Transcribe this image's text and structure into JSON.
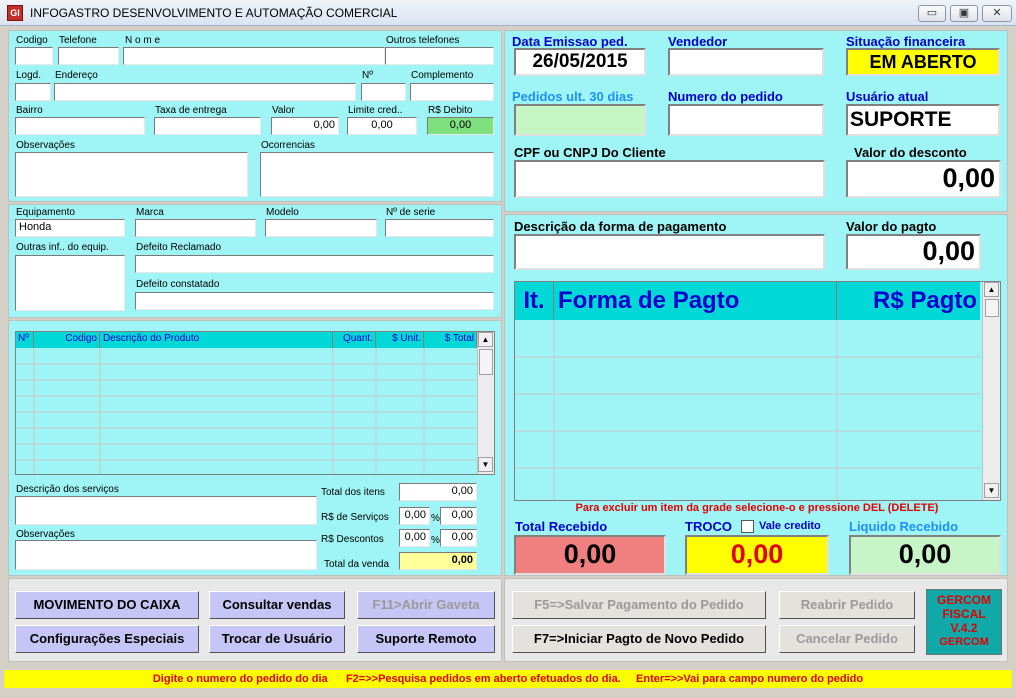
{
  "window": {
    "title": "INFOGASTRO DESENVOLVIMENTO E AUTOMAÇÃO COMERCIAL",
    "icon_text": "GI",
    "min": "▭",
    "max": "▣",
    "close": "✕"
  },
  "customer": {
    "codigo_label": "Codigo",
    "telefone_label": "Telefone",
    "nome_label": "N o m e",
    "outros_tel_label": "Outros telefones",
    "logd_label": "Logd.",
    "endereco_label": "Endereço",
    "numero_label": "Nº",
    "complemento_label": "Complemento",
    "bairro_label": "Bairro",
    "taxa_label": "Taxa de entrega",
    "valor_label": "Valor",
    "valor_value": "0,00",
    "limite_label": "Limite cred..",
    "limite_value": "0,00",
    "debito_label": "R$  Debito",
    "debito_value": "0,00",
    "obs_label": "Observações",
    "ocorrencias_label": "Ocorrencias"
  },
  "equipment": {
    "equip_label": "Equipamento",
    "equip_value": "Honda",
    "marca_label": "Marca",
    "modelo_label": "Modelo",
    "serie_label": "Nº de serie",
    "outras_label": "Outras inf.. do equip.",
    "defeito_rec_label": "Defeito Reclamado",
    "defeito_const_label": "Defeito constatado"
  },
  "products": {
    "headers": [
      "Nº",
      "Codigo",
      "Descrição do Produto",
      "Quant.",
      "$ Unit.",
      "$ Total"
    ],
    "servicos_label": "Descrição dos serviços",
    "obs_label": "Observações",
    "total_itens_label": "Total  dos  itens",
    "total_itens_value": "0,00",
    "servicos_rs_label": "R$ de Serviços",
    "servicos_pct": "0,00",
    "servicos_val": "0,00",
    "descontos_label": "R$   Descontos",
    "descontos_pct": "0,00",
    "descontos_val": "0,00",
    "total_venda_label": "Total da venda",
    "total_venda_value": "0,00",
    "pct_sign": "%"
  },
  "order": {
    "data_label": "Data Emissao ped.",
    "data_value": "26/05/2015",
    "vendedor_label": "Vendedor",
    "situacao_label": "Situação financeira",
    "situacao_value": "EM ABERTO",
    "pedidos30_label": "Pedidos ult. 30 dias",
    "numero_label": "Numero do pedido",
    "usuario_label": "Usuário atual",
    "usuario_value": "SUPORTE",
    "cpf_label": "CPF  ou  CNPJ Do Cliente",
    "desconto_label": "Valor do desconto",
    "desconto_value": "0,00",
    "descpag_label": "Descrição da forma de pagamento",
    "valorpag_label": "Valor do pagto",
    "valorpag_value": "0,00"
  },
  "payments": {
    "headers": [
      "It.",
      "Forma  de  Pagto",
      "R$ Pagto"
    ],
    "hint": "Para excluir um item da grade selecione-o e pressione DEL (DELETE)"
  },
  "totals": {
    "recebido_label": "Total Recebido",
    "recebido_value": "0,00",
    "troco_label": "TROCO",
    "vale_label": "Vale credito",
    "troco_value": "0,00",
    "liquido_label": "Liquido Recebido",
    "liquido_value": "0,00"
  },
  "buttons": {
    "movimento": "MOVIMENTO DO CAIXA",
    "consultar": "Consultar vendas",
    "gaveta": "F11>Abrir Gaveta",
    "config": "Configurações Especiais",
    "trocar": "Trocar de Usuário",
    "suporte": "Suporte Remoto",
    "salvar": "F5=>Salvar Pagamento do Pedido",
    "reabrir": "Reabrir Pedido",
    "iniciar": "F7=>Iniciar Pagto de Novo Pedido",
    "cancelar": "Cancelar Pedido"
  },
  "badge": {
    "line1": "GERCOM",
    "line2": "FISCAL",
    "line3": "V.4.2",
    "line4": "GERCOM"
  },
  "status": {
    "text": "Digite o numero do pedido do dia      F2=>>Pesquisa pedidos em aberto efetuados do dia.     Enter=>>Vai para campo numero do pedido"
  },
  "colors": {
    "panel": "#9ff5f5",
    "grid_header": "#00d8d8",
    "accent_blue": "#0000cc",
    "status_yellow": "#ffff00",
    "recebido_bg": "#f08080",
    "troco_bg": "#ffff00",
    "liquido_bg": "#c8f5c8"
  }
}
